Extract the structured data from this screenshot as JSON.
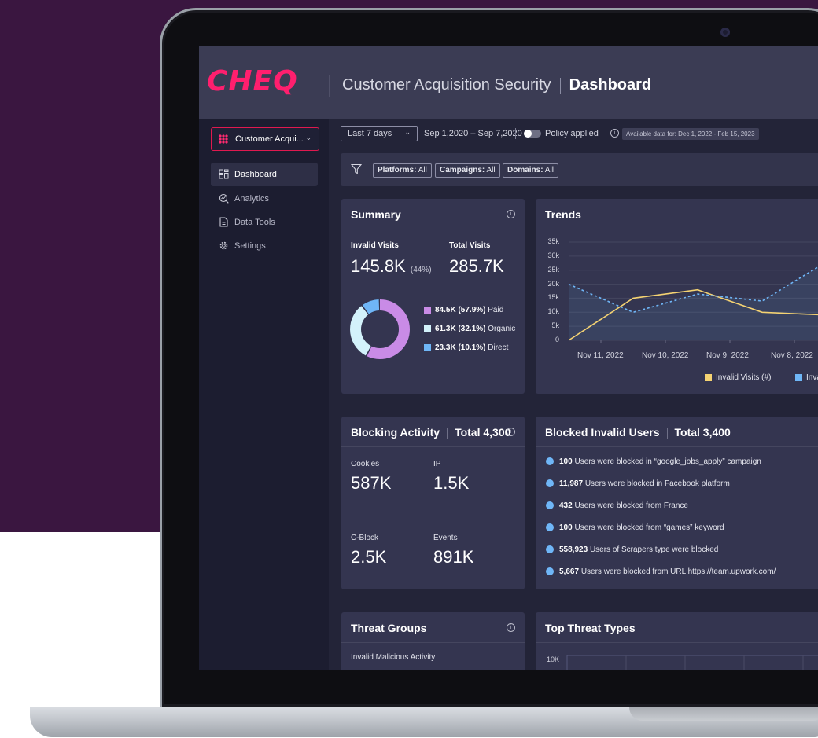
{
  "app": {
    "logo": "CHEQ",
    "product": "Customer Acquisition Security",
    "page": "Dashboard"
  },
  "sidebar": {
    "selector": "Customer Acqui...",
    "items": [
      {
        "label": "Dashboard",
        "icon": "dashboard-grid-icon",
        "active": true
      },
      {
        "label": "Analytics",
        "icon": "analytics-icon",
        "active": false
      },
      {
        "label": "Data Tools",
        "icon": "data-tools-icon",
        "active": false
      },
      {
        "label": "Settings",
        "icon": "gear-icon",
        "active": false
      }
    ]
  },
  "toolbar": {
    "range": "Last 7 days",
    "dates": "Sep 1,2020 – Sep 7,2020",
    "policy": "Policy applied",
    "available": "Available data for: Dec 1, 2022 - Feb 15, 2023"
  },
  "filters": [
    {
      "key": "Platforms:",
      "value": "All"
    },
    {
      "key": "Campaigns:",
      "value": "All"
    },
    {
      "key": "Domains:",
      "value": "All"
    }
  ],
  "summary": {
    "title": "Summary",
    "invalid_label": "Invalid Visits",
    "invalid_value": "145.8K",
    "invalid_pct": "(44%)",
    "total_label": "Total Visits",
    "total_value": "285.7K",
    "legend": [
      {
        "value": "84.5K (57.9%)",
        "label": "Paid",
        "color": "#c98be6"
      },
      {
        "value": "61.3K (32.1%)",
        "label": "Organic",
        "color": "#d3f2fb"
      },
      {
        "value": "23.3K (10.1%)",
        "label": "Direct",
        "color": "#6fb6f7"
      }
    ]
  },
  "trends": {
    "title": "Trends",
    "legend": [
      {
        "label": "Invalid Visits (#)",
        "color": "#f5d372"
      },
      {
        "label": "Inva",
        "color": "#6fb6f7"
      }
    ]
  },
  "chart_data": {
    "type": "line",
    "x": [
      "Nov 11, 2022",
      "Nov 10, 2022",
      "Nov 9, 2022",
      "Nov 8, 2022"
    ],
    "yticks": [
      "35k",
      "30k",
      "25k",
      "20k",
      "15k",
      "10k",
      "5k",
      "0"
    ],
    "ylim": [
      0,
      35000
    ],
    "series": [
      {
        "name": "Invalid Visits (#)",
        "color": "#f5d372",
        "points": [
          [
            0,
            0
          ],
          [
            1,
            15000
          ],
          [
            2,
            18000
          ],
          [
            3,
            10000
          ],
          [
            4,
            9000
          ]
        ]
      },
      {
        "name": "Inva",
        "color": "#6fb6f7",
        "style": "dashed",
        "points": [
          [
            0,
            20000
          ],
          [
            1,
            10000
          ],
          [
            2,
            16500
          ],
          [
            3,
            14000
          ],
          [
            4,
            28000
          ]
        ]
      }
    ]
  },
  "blocking": {
    "title": "Blocking Activity",
    "total": "Total 4,300",
    "stats": [
      {
        "label": "Cookies",
        "value": "587K"
      },
      {
        "label": "IP",
        "value": "1.5K"
      },
      {
        "label": "C-Block",
        "value": "2.5K"
      },
      {
        "label": "Events",
        "value": "891K"
      }
    ]
  },
  "blocked_users": {
    "title": "Blocked Invalid Users",
    "total": "Total 3,400",
    "rows": [
      {
        "count": "100",
        "text": "Users were blocked in “google_jobs_apply” campaign"
      },
      {
        "count": "11,987",
        "text": "Users were blocked in Facebook platform"
      },
      {
        "count": "432",
        "text": "Users were blocked from France"
      },
      {
        "count": "100",
        "text": "Users were blocked from “games” keyword"
      },
      {
        "count": "558,923",
        "text": "Users of Scrapers type were blocked"
      },
      {
        "count": "5,667",
        "text": "Users were blocked from URL https://team.upwork.com/"
      }
    ]
  },
  "threat_groups": {
    "title": "Threat Groups",
    "label": "Invalid Malicious Activity"
  },
  "top_threats": {
    "title": "Top Threat Types",
    "ytick": "10K"
  },
  "colors": {
    "accent": "#ff1f6e",
    "background": "#3a1640",
    "screen": "#232438",
    "card": "#343550"
  }
}
